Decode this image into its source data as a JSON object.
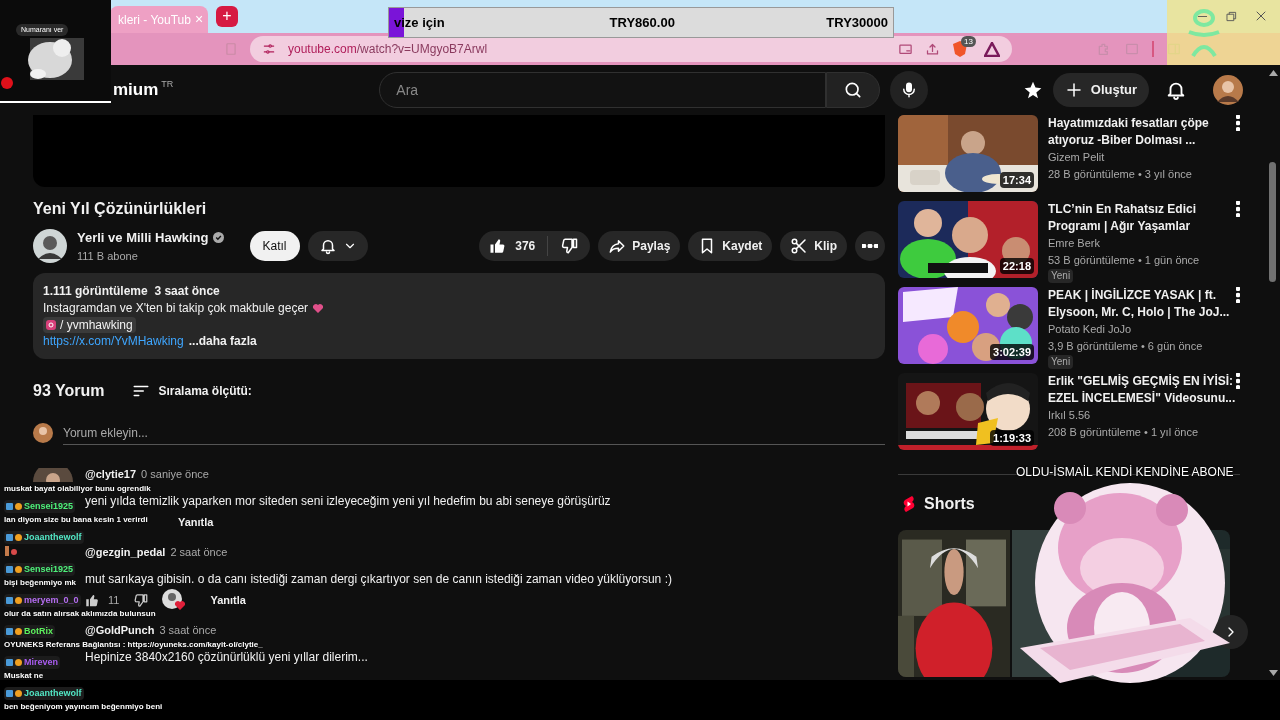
{
  "browser": {
    "tab": {
      "title": "kleri - YouTub",
      "close": "×"
    },
    "new_tab": "+",
    "address": {
      "domain": "youtube.com",
      "path": "/watch?v=UMgyoB7Arwl"
    },
    "shield_count": "13"
  },
  "stream_overlay": {
    "webcam_label": "Numaranı ver",
    "goal": {
      "label": "vize için",
      "current": "TRY860.00",
      "target": "TRY30000",
      "level": 0.03
    },
    "banner": "OLDU-İSMAİL KENDİ KENDİNE ABONE",
    "chat": [
      {
        "kind": "text",
        "message": "muskat bayat olabiliyor bunu ogrendik"
      },
      {
        "kind": "text",
        "name": "Sensei1925",
        "color": "#4ef07a",
        "message": "lan diyom size bu bana kesin 1 verirdi"
      },
      {
        "kind": "emote",
        "name": "Joaanthewolf",
        "color": "#52e6c4"
      },
      {
        "kind": "text",
        "name": "Sensei1925",
        "color": "#4ef07a",
        "message": "bişi beğenmiyo mk"
      },
      {
        "kind": "text",
        "name": "meryem_0_0",
        "color": "#b46cf0",
        "message": "olur da satın alırsak aklımızda bulunsun"
      },
      {
        "kind": "text",
        "name": "BotRix",
        "color": "#5df05d",
        "message": "OYUNEKS Referans Bağlantısı : https://oyuneks.com/kayit-ol/clytie_"
      },
      {
        "kind": "text",
        "name": "Mireven",
        "color": "#a95cf0",
        "message": "Muskat ne"
      },
      {
        "kind": "text",
        "name": "Joaanthewolf",
        "color": "#52e6c4",
        "message": "ben beğeniyom yayıncım beğenmiyo beni"
      }
    ]
  },
  "header": {
    "logo": "mium",
    "country": "TR",
    "search": {
      "placeholder": "Ara"
    },
    "create": "Oluştur"
  },
  "video": {
    "title": "Yeni Yıl Çözünürlükleri",
    "channel": {
      "name": "Yerli ve Milli Hawking",
      "verified": true,
      "subscribers": "111 B abone"
    },
    "join": "Katıl",
    "likes": "376",
    "actions": [
      {
        "kind": "share",
        "label": "Paylaş"
      },
      {
        "kind": "save",
        "label": "Kaydet"
      },
      {
        "kind": "clip",
        "label": "Klip"
      }
    ],
    "description": {
      "stats": "1.111 görüntüleme  3 saat önce",
      "text": "Instagramdan ve X'ten bi takip çok makbule geçer",
      "instagram": "/ yvmhawking",
      "link": "https://x.com/YvMHawking",
      "more": "...daha fazla"
    }
  },
  "comments": {
    "count": "93 Yorum",
    "sort": "Sıralama ölçütü:",
    "add": {
      "placeholder": "Yorum ekleyin..."
    },
    "items": [
      {
        "author": "@clytie17",
        "avatar": true,
        "time": "0 saniye önce",
        "text": "yeni yılda temizlik yaparken mor siteden seni izleyeceğim yeni yıl hedefim bu abi seneye görüşürüz",
        "reply": "Yanıtla",
        "creator_heart": false
      },
      {
        "author": "@gezgin_pedal",
        "avatar": false,
        "time": "2 saat önce",
        "text": "mut sarıkaya gibisin. o da canı istediği zaman dergi çıkartıyor sen de canın istediği zaman video yüklüyorsun :)",
        "likes": "11",
        "reply": "Yanıtla",
        "creator_heart": true
      },
      {
        "author": "@GoldPunch",
        "avatar": false,
        "time": "3 saat önce",
        "text": "Hepinize 3840x2160 çözünürlüklü yeni yıllar dilerim...",
        "creator_heart": false
      }
    ]
  },
  "recommended": [
    {
      "title_lines": [
        "Hayatımızdaki fesatları çöpe",
        "atıyoruz -Biber Dolması ..."
      ],
      "channel": "Gizem Pelit",
      "meta": "28 B görüntüleme • 3 yıl önce",
      "duration": "17:34"
    },
    {
      "title_lines": [
        "TLC’nin En Rahatsız Edici",
        "Programı | Ağır Yaşamlar"
      ],
      "channel": "Emre Berk",
      "meta": "53 B görüntüleme • 1 gün önce",
      "duration": "22:18",
      "badge": "Yeni"
    },
    {
      "title_lines": [
        "PEAK | İNGİLİZCE YASAK | ft.",
        "Elysoon, Mr. C, Holo | The JoJ..."
      ],
      "channel": "Potato Kedi JoJo",
      "meta": "3,9 B görüntüleme • 6 gün önce",
      "duration": "3:02:39",
      "badge": "Yeni"
    },
    {
      "title_lines": [
        "Erlik \"GELMİŞ GEÇMİŞ EN İYİSİ:",
        "EZEL İNCELEMESİ\" Videosunu..."
      ],
      "channel": "Irkıl 5.56",
      "meta": "208 B görüntüleme • 1 yıl önce",
      "duration": "1:19:33"
    }
  ],
  "shorts": {
    "title": "Shorts"
  }
}
